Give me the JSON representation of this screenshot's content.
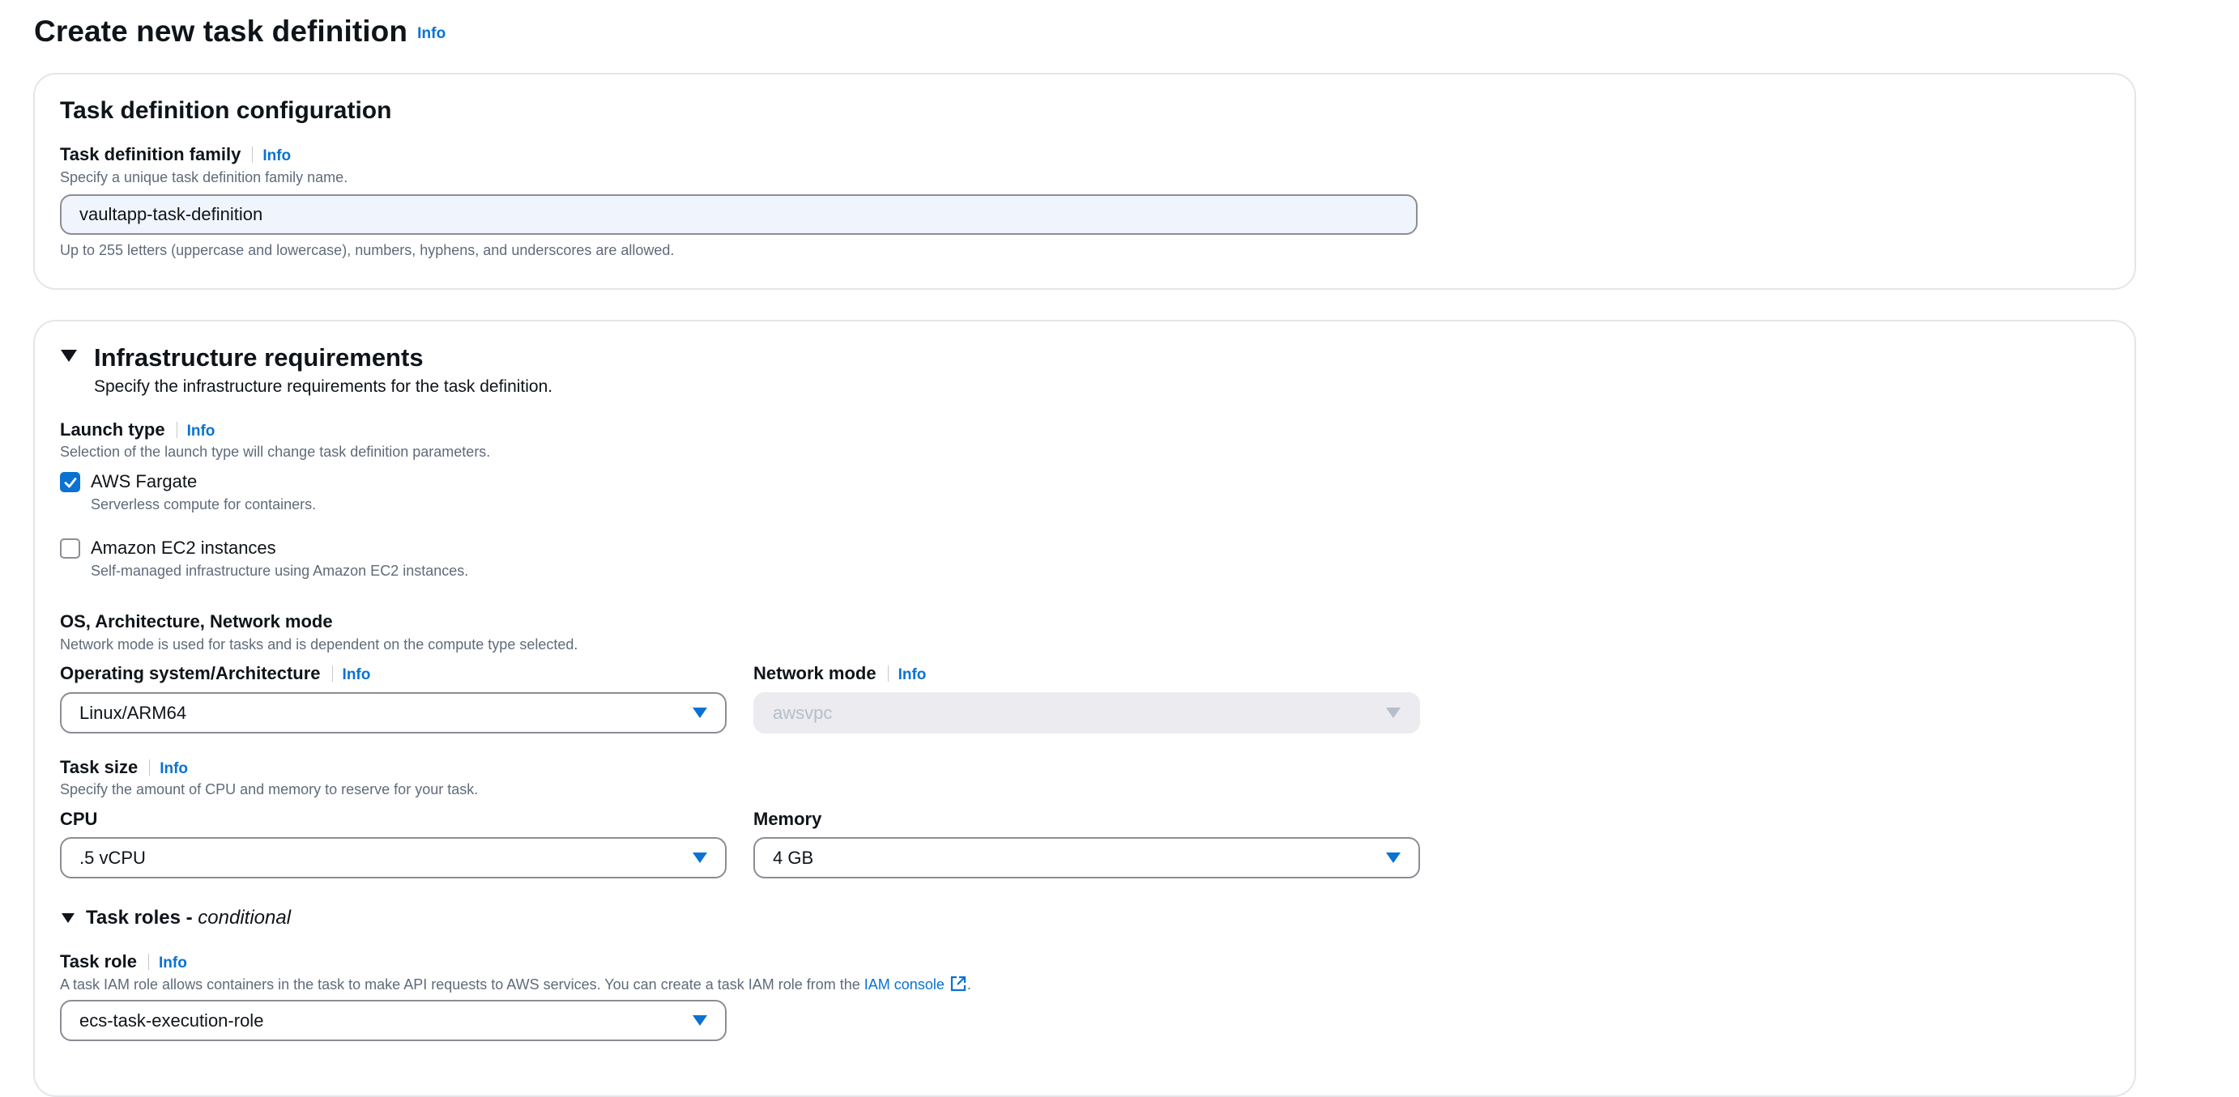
{
  "page": {
    "title": "Create new task definition",
    "info": "Info"
  },
  "config": {
    "title": "Task definition configuration",
    "family": {
      "label": "Task definition family",
      "info": "Info",
      "description": "Specify a unique task definition family name.",
      "value": "vaultapp-task-definition",
      "constraint": "Up to 255 letters (uppercase and lowercase), numbers, hyphens, and underscores are allowed."
    }
  },
  "infra": {
    "title": "Infrastructure requirements",
    "description": "Specify the infrastructure requirements for the task definition.",
    "launch_type": {
      "label": "Launch type",
      "info": "Info",
      "description": "Selection of the launch type will change task definition parameters.",
      "options": [
        {
          "label": "AWS Fargate",
          "description": "Serverless compute for containers.",
          "checked": true
        },
        {
          "label": "Amazon EC2 instances",
          "description": "Self-managed infrastructure using Amazon EC2 instances.",
          "checked": false
        }
      ]
    },
    "os_arch_net": {
      "label": "OS, Architecture, Network mode",
      "description": "Network mode is used for tasks and is dependent on the compute type selected.",
      "os": {
        "label": "Operating system/Architecture",
        "info": "Info",
        "value": "Linux/ARM64"
      },
      "network": {
        "label": "Network mode",
        "info": "Info",
        "value": "awsvpc",
        "disabled": true
      }
    },
    "task_size": {
      "label": "Task size",
      "info": "Info",
      "description": "Specify the amount of CPU and memory to reserve for your task.",
      "cpu": {
        "label": "CPU",
        "value": ".5 vCPU"
      },
      "memory": {
        "label": "Memory",
        "value": "4 GB"
      }
    },
    "task_roles": {
      "title": "Task roles - ",
      "title_suffix": "conditional",
      "role": {
        "label": "Task role",
        "info": "Info",
        "description": "A task IAM role allows containers in the task to make API requests to AWS services. You can create a task IAM role from the ",
        "link": "IAM console",
        "description_end": ".",
        "value": "ecs-task-execution-role"
      }
    }
  },
  "colors": {
    "accent": "#0972d3",
    "text": "#0f141a",
    "muted": "#5f6b7a",
    "border": "#8c8c94"
  },
  "icons": [
    "caret-down-icon",
    "checkmark-icon",
    "external-link-icon",
    "expand-triangle-icon"
  ]
}
